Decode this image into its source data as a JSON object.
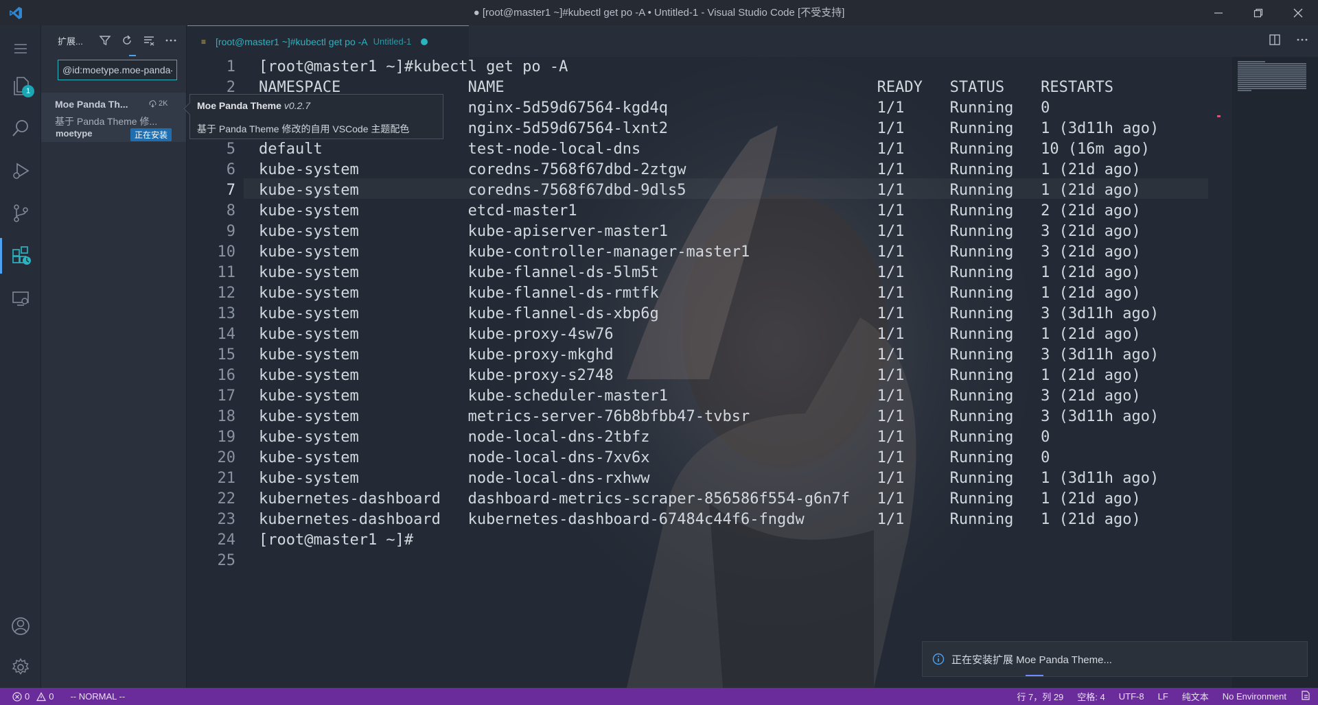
{
  "window": {
    "title": "● [root@master1 ~]#kubectl get po -A • Untitled-1 - Visual Studio Code [不受支持]"
  },
  "activity_bar": {
    "explorer_badge": "1"
  },
  "sidebar": {
    "title": "扩展...",
    "search_value": "@id:moetype.moe-panda-theme",
    "extension": {
      "name": "Moe Panda Th...",
      "downloads": "2K",
      "description": "基于 Panda Theme 修...",
      "publisher": "moetype",
      "status": "正在安装"
    }
  },
  "tooltip": {
    "name": "Moe Panda Theme",
    "version": "v0.2.7",
    "description": "基于 Panda Theme 修改的自用 VSCode 主题配色"
  },
  "tab": {
    "label": "[root@master1 ~]#kubectl get po -A",
    "description": "Untitled-1"
  },
  "editor": {
    "lines": [
      {
        "n": "1",
        "text": "[root@master1 ~]#kubectl get po -A"
      },
      {
        "n": "2",
        "text": "NAMESPACE              NAME                                         READY   STATUS    RESTARTS"
      },
      {
        "n": "3",
        "text": "                       nginx-5d59d67564-kgd4q                       1/1     Running   0"
      },
      {
        "n": "4",
        "text": "                       nginx-5d59d67564-lxnt2                       1/1     Running   1 (3d11h ago)"
      },
      {
        "n": "5",
        "text": "default                test-node-local-dns                          1/1     Running   10 (16m ago)"
      },
      {
        "n": "6",
        "text": "kube-system            coredns-7568f67dbd-2ztgw                     1/1     Running   1 (21d ago)"
      },
      {
        "n": "7",
        "text": "kube-system            coredns-7568f67dbd-9dls5                     1/1     Running   1 (21d ago)"
      },
      {
        "n": "8",
        "text": "kube-system            etcd-master1                                 1/1     Running   2 (21d ago)"
      },
      {
        "n": "9",
        "text": "kube-system            kube-apiserver-master1                       1/1     Running   3 (21d ago)"
      },
      {
        "n": "10",
        "text": "kube-system            kube-controller-manager-master1              1/1     Running   3 (21d ago)"
      },
      {
        "n": "11",
        "text": "kube-system            kube-flannel-ds-5lm5t                        1/1     Running   1 (21d ago)"
      },
      {
        "n": "12",
        "text": "kube-system            kube-flannel-ds-rmtfk                        1/1     Running   1 (21d ago)"
      },
      {
        "n": "13",
        "text": "kube-system            kube-flannel-ds-xbp6g                        1/1     Running   3 (3d11h ago)"
      },
      {
        "n": "14",
        "text": "kube-system            kube-proxy-4sw76                             1/1     Running   1 (21d ago)"
      },
      {
        "n": "15",
        "text": "kube-system            kube-proxy-mkghd                             1/1     Running   3 (3d11h ago)"
      },
      {
        "n": "16",
        "text": "kube-system            kube-proxy-s2748                             1/1     Running   1 (21d ago)"
      },
      {
        "n": "17",
        "text": "kube-system            kube-scheduler-master1                       1/1     Running   3 (21d ago)"
      },
      {
        "n": "18",
        "text": "kube-system            metrics-server-76b8bfbb47-tvbsr              1/1     Running   3 (3d11h ago)"
      },
      {
        "n": "19",
        "text": "kube-system            node-local-dns-2tbfz                         1/1     Running   0"
      },
      {
        "n": "20",
        "text": "kube-system            node-local-dns-7xv6x                         1/1     Running   0"
      },
      {
        "n": "21",
        "text": "kube-system            node-local-dns-rxhww                         1/1     Running   1 (3d11h ago)"
      },
      {
        "n": "22",
        "text": "kubernetes-dashboard   dashboard-metrics-scraper-856586f554-g6n7f   1/1     Running   1 (21d ago)"
      },
      {
        "n": "23",
        "text": "kubernetes-dashboard   kubernetes-dashboard-67484c44f6-fngdw        1/1     Running   1 (21d ago)"
      },
      {
        "n": "24",
        "text": "[root@master1 ~]#"
      },
      {
        "n": "25",
        "text": ""
      }
    ]
  },
  "notification": {
    "text": "正在安装扩展 Moe Panda Theme..."
  },
  "status_bar": {
    "errors": "0",
    "warnings": "0",
    "mode": "-- NORMAL --",
    "position": "行 7，列 29",
    "indent": "空格: 4",
    "encoding": "UTF-8",
    "eol": "LF",
    "language": "纯文本",
    "environment": "No Environment"
  },
  "colors": {
    "accent": "#2bb3c0",
    "status_bar": "#6a2c9b",
    "editor_bg": "#232a35"
  }
}
